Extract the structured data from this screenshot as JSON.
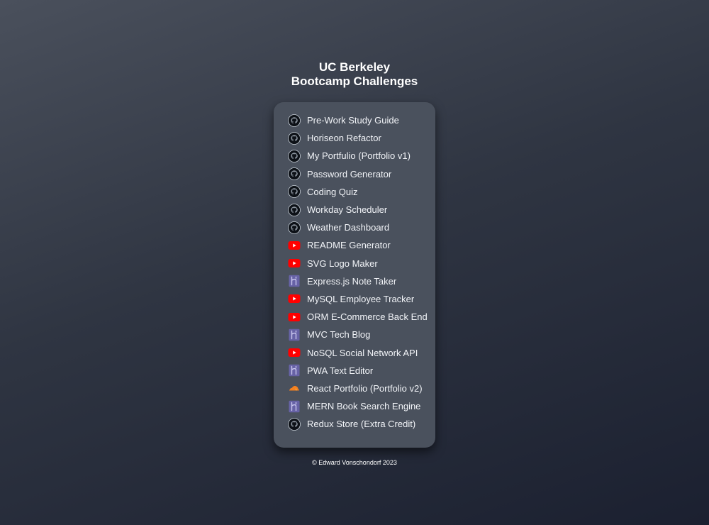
{
  "header": {
    "title_line1": "UC Berkeley",
    "title_line2": "Bootcamp Challenges"
  },
  "links": [
    {
      "label": "Pre-Work Study Guide",
      "icon": "github-icon"
    },
    {
      "label": "Horiseon Refactor",
      "icon": "github-icon"
    },
    {
      "label": "My Portfulio (Portfolio v1)",
      "icon": "github-icon"
    },
    {
      "label": "Password Generator",
      "icon": "github-icon"
    },
    {
      "label": "Coding Quiz",
      "icon": "github-icon"
    },
    {
      "label": "Workday Scheduler",
      "icon": "github-icon"
    },
    {
      "label": "Weather Dashboard",
      "icon": "github-icon"
    },
    {
      "label": "README Generator",
      "icon": "youtube-icon"
    },
    {
      "label": "SVG Logo Maker",
      "icon": "youtube-icon"
    },
    {
      "label": "Express.js Note Taker",
      "icon": "heroku-icon"
    },
    {
      "label": "MySQL Employee Tracker",
      "icon": "youtube-icon"
    },
    {
      "label": "ORM E-Commerce Back End",
      "icon": "youtube-icon"
    },
    {
      "label": "MVC Tech Blog",
      "icon": "heroku-icon"
    },
    {
      "label": "NoSQL Social Network API",
      "icon": "youtube-icon"
    },
    {
      "label": "PWA Text Editor",
      "icon": "heroku-icon"
    },
    {
      "label": "React Portfolio (Portfolio v2)",
      "icon": "cloudflare-icon"
    },
    {
      "label": "MERN Book Search Engine",
      "icon": "heroku-icon"
    },
    {
      "label": "Redux Store (Extra Credit)",
      "icon": "github-icon"
    }
  ],
  "footer": {
    "copyright": "© Edward Vonschondorf 2023"
  },
  "colors": {
    "card": "#4a515d",
    "youtube": "#ff0000",
    "heroku": "#6762a6",
    "cloudflare": "#f38020",
    "github": "#1b1f24"
  }
}
